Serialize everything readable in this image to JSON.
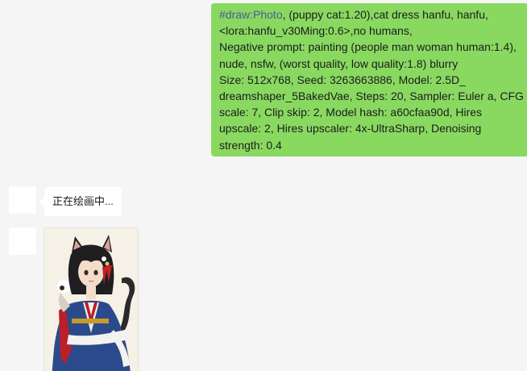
{
  "messages": {
    "outgoing": {
      "command": "#draw:Photo",
      "text": ", (puppy cat:1.20),cat dress hanfu, hanfu, <lora:hanfu_v30Ming:0.6>,no humans,\nNegative prompt: painting (people man woman human:1.4), nude, nsfw, (worst quality, low quality:1.8) blurry\nSize: 512x768, Seed: 3263663886, Model: 2.5D_ dreamshaper_5BakedVae, Steps: 20, Sampler: Euler a, CFG scale: 7, Clip skip: 2, Model hash: a60cfaa90d, Hires upscale: 2, Hires upscaler: 4x-UltraSharp, Denoising strength: 0.4"
    },
    "incoming_status": {
      "text": "正在绘画中..."
    }
  },
  "colors": {
    "background": "#f5f5f5",
    "outgoing_bubble": "#89d961",
    "incoming_bubble": "#ffffff",
    "command_text": "#4a5a9a"
  }
}
